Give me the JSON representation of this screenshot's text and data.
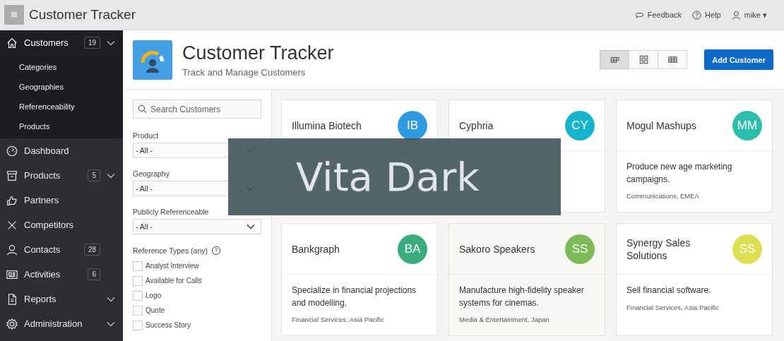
{
  "app_bar": {
    "title": "Customer Tracker",
    "links": [
      {
        "kind": "feedback",
        "label": "Feedback"
      },
      {
        "kind": "help",
        "label": "Help"
      },
      {
        "kind": "user",
        "label": "mike ▾"
      }
    ]
  },
  "sidebar": {
    "items": [
      {
        "kind": "home",
        "label": "Customers",
        "badge": "19",
        "submenu": true,
        "selected": true,
        "children": [
          {
            "label": "Categories"
          },
          {
            "label": "Geographies"
          },
          {
            "label": "Referenceability"
          },
          {
            "label": "Products"
          }
        ]
      },
      {
        "kind": "dashboard",
        "label": "Dashboard",
        "submenu": false,
        "selected": false
      },
      {
        "kind": "box",
        "label": "Products",
        "badge": "5",
        "submenu": true,
        "selected": false
      },
      {
        "kind": "hand",
        "label": "Partners",
        "submenu": false,
        "selected": false
      },
      {
        "kind": "cross",
        "label": "Competitors",
        "submenu": false,
        "selected": false
      },
      {
        "kind": "person",
        "label": "Contacts",
        "badge": "28",
        "submenu": false,
        "selected": false
      },
      {
        "kind": "news",
        "label": "Activities",
        "badge": "6",
        "submenu": false,
        "selected": false
      },
      {
        "kind": "doc",
        "label": "Reports",
        "submenu": true,
        "selected": false
      },
      {
        "kind": "gear",
        "label": "Administration",
        "submenu": true,
        "selected": false
      }
    ]
  },
  "header": {
    "title": "Customer Tracker",
    "subtitle": "Track and Manage Customers",
    "views": [
      {
        "kind": "cards",
        "selected": true
      },
      {
        "kind": "tiles",
        "selected": false
      },
      {
        "kind": "table",
        "selected": false
      }
    ],
    "primary_button": "Add Customer"
  },
  "filters": {
    "search": {
      "placeholder": "Search Customers"
    },
    "selects": [
      {
        "label": "Product",
        "value": "- All -"
      },
      {
        "label": "Geography",
        "value": "- All -"
      },
      {
        "label": "Publicly Referenceable",
        "value": "- All -"
      }
    ],
    "reference_types": {
      "label": "Reference Types (any)",
      "options": [
        {
          "label": "Analyst Interview",
          "checked": false
        },
        {
          "label": "Available for Calls",
          "checked": false
        },
        {
          "label": "Logo",
          "checked": false
        },
        {
          "label": "Quote",
          "checked": false
        },
        {
          "label": "Success Story",
          "checked": false
        }
      ]
    }
  },
  "cards": [
    {
      "name": "Illumina Biotech",
      "initials": "IB",
      "color": "#2f9ae0",
      "selected": false
    },
    {
      "name": "Cyphria",
      "initials": "CY",
      "color": "#14b5cc",
      "selected": false
    },
    {
      "name": "Mogul Mashups",
      "initials": "MM",
      "color": "#2cbfae",
      "description": "Produce new age marketing campaigns.",
      "meta": "Communications, EMEA",
      "selected": false
    },
    {
      "name": "Bankgraph",
      "initials": "BA",
      "color": "#3aab7c",
      "description": "Specialize in financial projections and modelling.",
      "meta": "Financial Services, Asia Pacific",
      "selected": false
    },
    {
      "name": "Sakoro Speakers",
      "initials": "SS",
      "color": "#7cba57",
      "description": "Manufacture high-fidelity speaker systems for cinemas.",
      "meta": "Media & Entertainment, Japan",
      "selected": true
    },
    {
      "name": "Synergy Sales Solutions",
      "initials": "SS",
      "color": "#dede52",
      "description": "Sell financial software.",
      "meta": "Financial Services, Asia Pacific",
      "selected": false
    }
  ],
  "overlay_caption": "Vita Dark"
}
